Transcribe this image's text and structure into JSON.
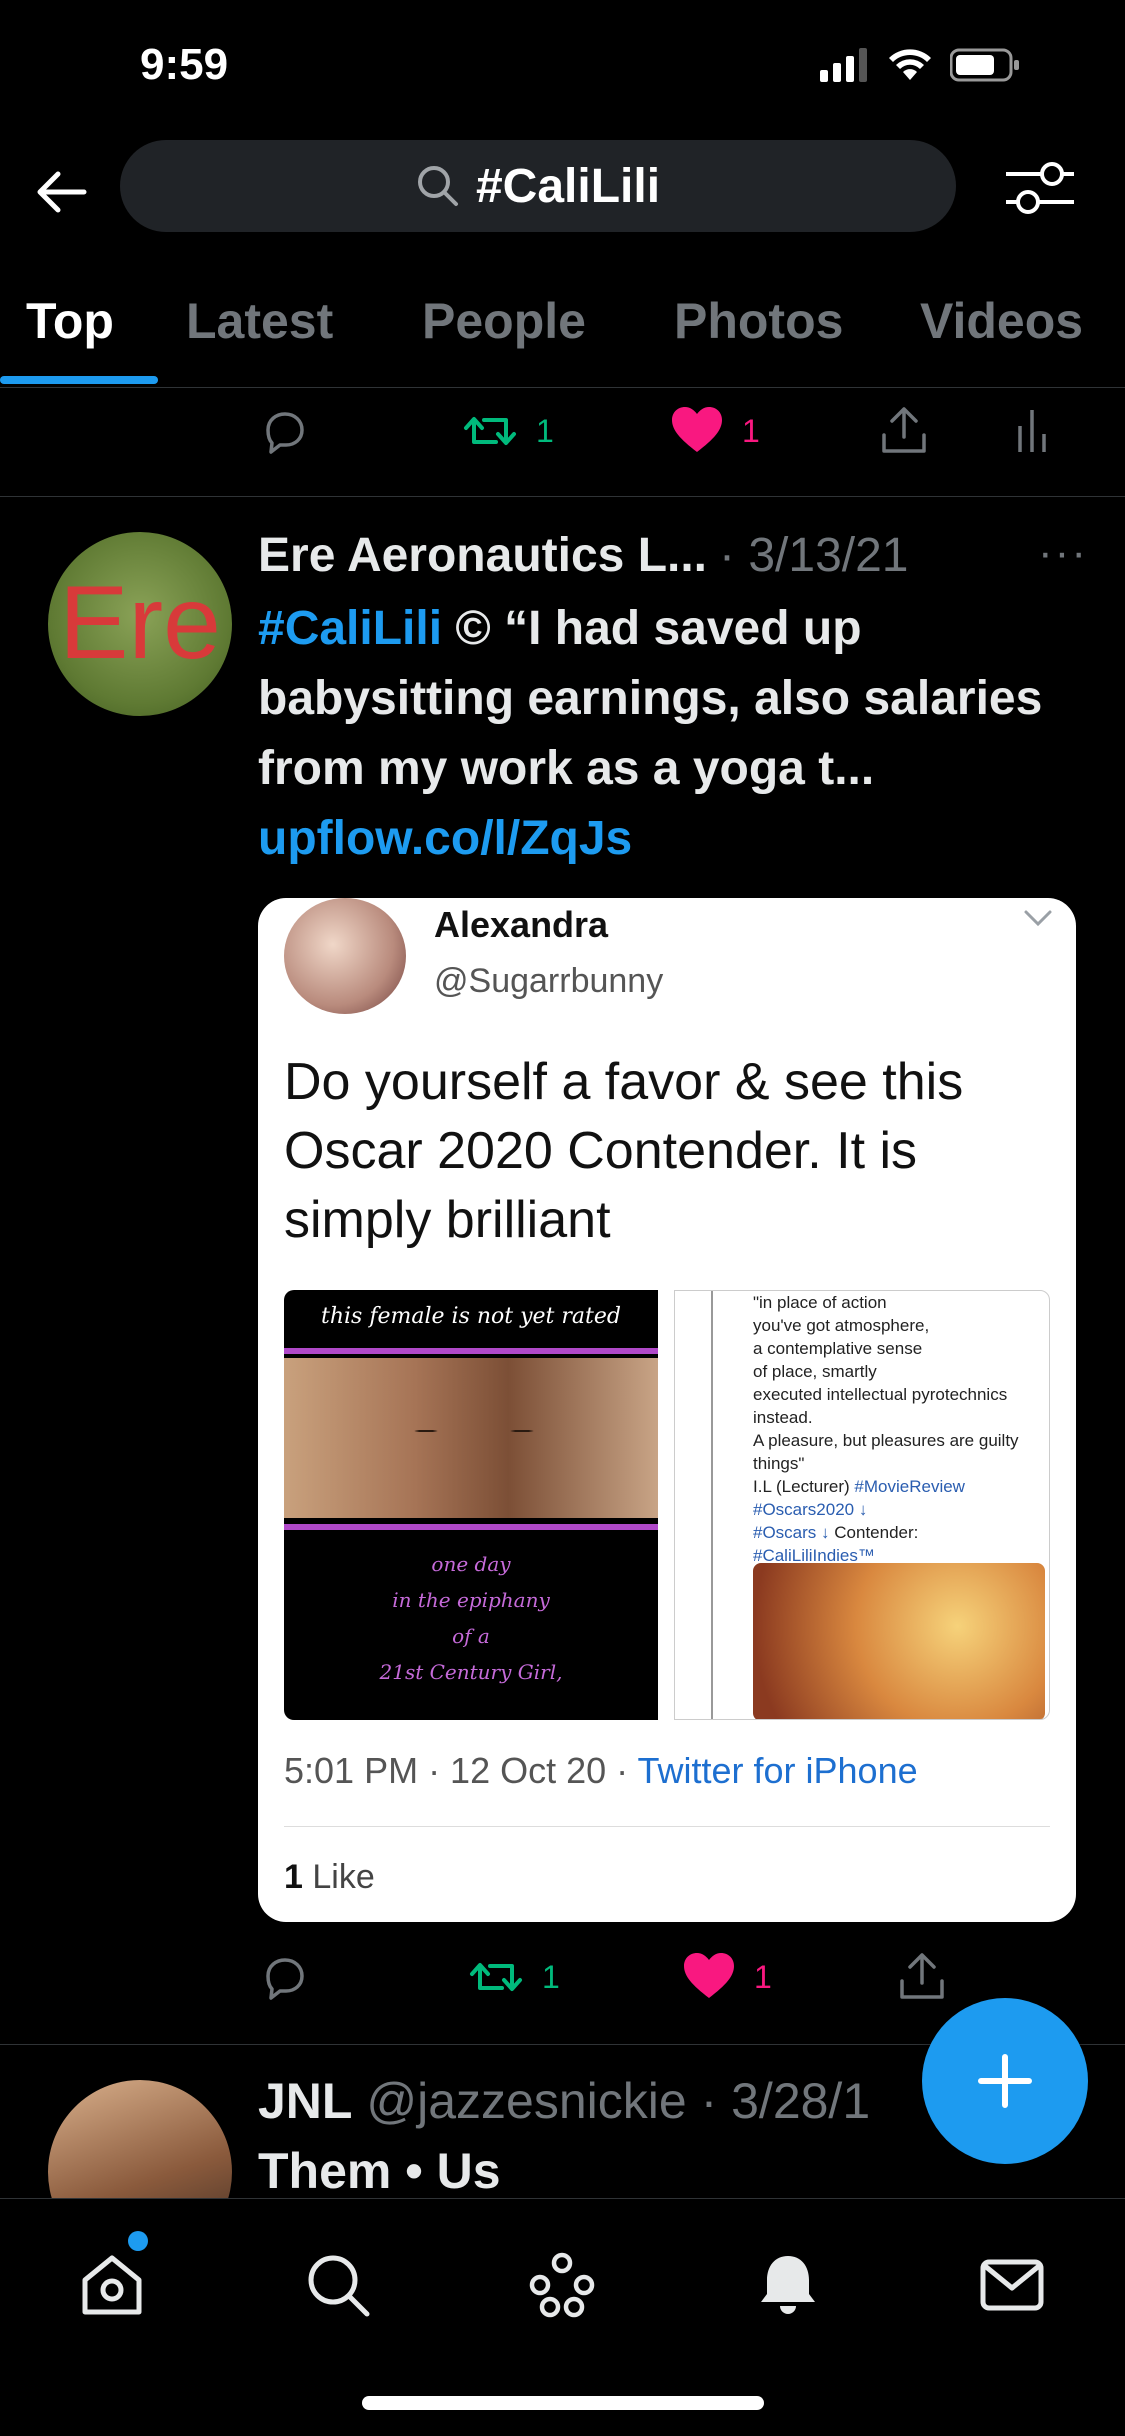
{
  "status_bar": {
    "time": "9:59"
  },
  "search": {
    "query": "#CaliLili"
  },
  "tabs": [
    {
      "label": "Top",
      "active": true
    },
    {
      "label": "Latest",
      "active": false
    },
    {
      "label": "People",
      "active": false
    },
    {
      "label": "Photos",
      "active": false
    },
    {
      "label": "Videos",
      "active": false
    }
  ],
  "prev_tweet_actions": {
    "retweets": "1",
    "likes": "1"
  },
  "tweet": {
    "avatar_text": "Ere",
    "author": "Ere Aeronautics L...",
    "date": "· 3/13/21",
    "more": "···",
    "hashtag": "#CaliLili",
    "text": " © “I had saved up babysitting earnings, also salaries from my work as a yoga t... ",
    "link": "upflow.co/l/ZqJs",
    "retweets": "1",
    "likes": "1"
  },
  "embedded": {
    "name": "Alexandra",
    "handle": "@Sugarrbunny",
    "text": "Do yourself a favor & see this Oscar 2020 Contender. It is simply brilliant",
    "left_image": {
      "top_caption": "this female is not yet rated",
      "bottom_lines": [
        "one day",
        "in the epiphany",
        "of a",
        "21st Century Girl,"
      ]
    },
    "right_image": {
      "lines": [
        "\"in place of action",
        "you've got atmosphere,",
        "a contemplative sense",
        "of place, smartly",
        "executed intellectual pyrotechnics",
        "instead.",
        "A pleasure, but pleasures are guilty",
        "things\""
      ],
      "tag_line_prefix": "I.L (Lecturer) ",
      "tag_line_tag": "#MovieReview",
      "oscars2020": "#Oscars2020 ↓",
      "oscars": "#Oscars ↓",
      "contender": "  Contender:",
      "indies": "#CaliLiliIndies™"
    },
    "time": "5:01 PM · 12 Oct 20 · ",
    "source": "Twitter for iPhone",
    "like_count": "1",
    "like_label": " Like"
  },
  "next_tweet": {
    "name": "JNL",
    "handle": " @jazzesnickie",
    "date": " · 3/28/1",
    "text": "Them • Us"
  },
  "icons": {
    "accent": "#1d9bf0",
    "retweet_color": "#00ba7c",
    "like_color": "#f91880"
  }
}
